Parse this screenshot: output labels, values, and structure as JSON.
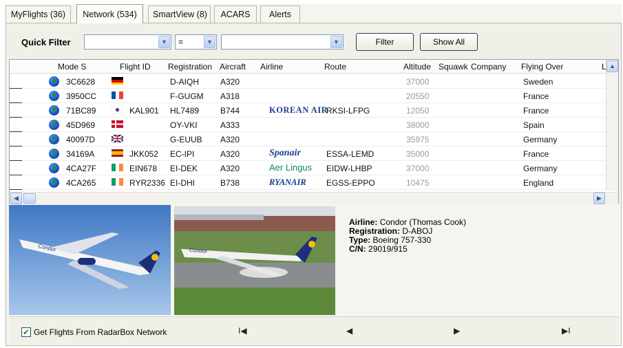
{
  "tabs": [
    {
      "label": "MyFlights (36)"
    },
    {
      "label": "Network (534)"
    },
    {
      "label": "SmartView (8)"
    },
    {
      "label": "ACARS"
    },
    {
      "label": "Alerts"
    }
  ],
  "filter": {
    "label": "Quick Filter",
    "field_value": "",
    "operator_value": "=",
    "value_value": "",
    "filter_button": "Filter",
    "show_all_button": "Show All"
  },
  "columns": [
    "Mode S",
    "Flight ID",
    "Registration",
    "Aircraft",
    "Airline",
    "Route",
    "Altitude",
    "Squawk",
    "Company",
    "Flying Over",
    "L"
  ],
  "rows": [
    {
      "mode_s": "3C6628",
      "flag": "germany",
      "flight_id": "",
      "registration": "D-AIQH",
      "aircraft": "A320",
      "airline": "",
      "route": "",
      "altitude": "37000",
      "flying_over": "Sweden"
    },
    {
      "mode_s": "3950CC",
      "flag": "france",
      "flight_id": "",
      "registration": "F-GUGM",
      "aircraft": "A318",
      "airline": "",
      "route": "",
      "altitude": "20550",
      "flying_over": "France"
    },
    {
      "mode_s": "71BC89",
      "flag": "south-korea",
      "flight_id": "KAL901",
      "registration": "HL7489",
      "aircraft": "B744",
      "airline": "KOREAN AIR",
      "route": "RKSI-LFPG",
      "altitude": "12050",
      "flying_over": "France"
    },
    {
      "mode_s": "45D969",
      "flag": "denmark",
      "flight_id": "",
      "registration": "OY-VKI",
      "aircraft": "A333",
      "airline": "",
      "route": "",
      "altitude": "38000",
      "flying_over": "Spain"
    },
    {
      "mode_s": "40097D",
      "flag": "uk",
      "flight_id": "",
      "registration": "G-EUUB",
      "aircraft": "A320",
      "airline": "",
      "route": "",
      "altitude": "35975",
      "flying_over": "Germany"
    },
    {
      "mode_s": "34169A",
      "flag": "spain",
      "flight_id": "JKK052",
      "registration": "EC-IPI",
      "aircraft": "A320",
      "airline": "Spanair",
      "route": "ESSA-LEMD",
      "altitude": "35000",
      "flying_over": "France"
    },
    {
      "mode_s": "4CA27F",
      "flag": "ireland",
      "flight_id": "EIN678",
      "registration": "EI-DEK",
      "aircraft": "A320",
      "airline": "Aer Lingus",
      "route": "EIDW-LHBP",
      "altitude": "37000",
      "flying_over": "Germany"
    },
    {
      "mode_s": "4CA265",
      "flag": "ireland",
      "flight_id": "RYR2336",
      "registration": "EI-DHI",
      "aircraft": "B738",
      "airline": "RYANAIR",
      "route": "EGSS-EPPO",
      "altitude": "10475",
      "flying_over": "England"
    }
  ],
  "details": {
    "airline_label": "Airline:",
    "airline": "Condor (Thomas Cook)",
    "registration_label": "Registration:",
    "registration": "D-ABOJ",
    "type_label": "Type:",
    "type": "Boeing 757-330",
    "cn_label": "C/N:",
    "cn": "29019/915"
  },
  "photo_text": {
    "livery": "Condor"
  },
  "bottom": {
    "checkbox_label": "Get Flights From RadarBox Network",
    "checked": true,
    "nav_first": "I◀",
    "nav_prev": "◀",
    "nav_next": "▶",
    "nav_last": "▶I"
  },
  "colors": {
    "panel": "#f5f4ee",
    "grid_border": "#8fa4b8",
    "korean_air": "#1f3c8f",
    "aer_lingus": "#0a8a5a",
    "spanair": "#1c3f91",
    "ryanair": "#173f8c"
  }
}
